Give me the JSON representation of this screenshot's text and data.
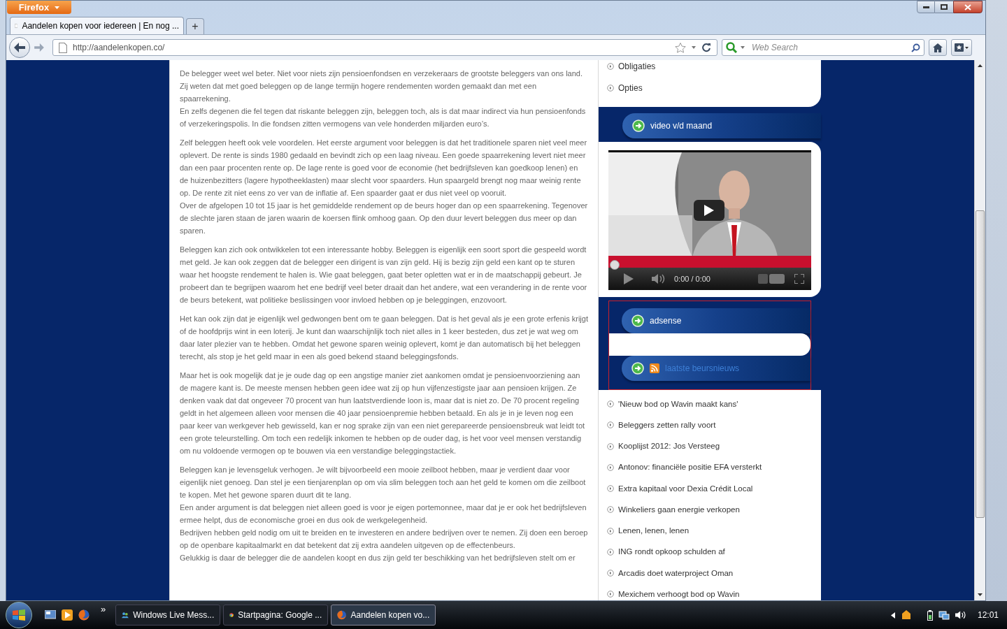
{
  "browser": {
    "menu_button": "Firefox",
    "tab": {
      "title": "Aandelen kopen voor iedereen | En nog ...",
      "selected": true
    },
    "new_tab": "+",
    "url": "http://aandelenkopen.co/",
    "search": {
      "placeholder": "Web Search"
    }
  },
  "article": {
    "paragraphs": [
      {
        "lines": [
          "De belegger weet wel beter. Niet voor niets zijn pensioenfondsen en verzekeraars de grootste beleggers van ons land. Zij weten dat met goed beleggen op de lange termijn hogere rendementen worden gemaakt dan met een spaarrekening.",
          "En zelfs degenen die fel tegen dat riskante beleggen zijn, beleggen toch, als is dat maar indirect via hun pensioenfonds of verzekeringspolis. In die fondsen zitten vermogens van vele honderden miljarden euro’s."
        ]
      },
      {
        "lines": [
          "Zelf beleggen heeft ook vele voordelen. Het eerste argument voor beleggen is dat het traditionele sparen niet veel meer oplevert. De rente is sinds 1980 gedaald en bevindt zich op een laag niveau. Een goede spaarrekening levert niet meer dan een paar procenten rente op. De lage rente is goed voor de economie (het bedrijfsleven kan goedkoop lenen) en de huizenbezitters (lagere hypotheeklasten) maar slecht voor spaarders. Hun spaargeld brengt nog maar weinig rente op. De rente zit niet eens zo ver van de inflatie af. Een spaarder gaat er dus niet veel op vooruit.",
          "Over de afgelopen 10 tot 15 jaar is het gemiddelde rendement op de beurs hoger dan op een spaarrekening. Tegenover de slechte jaren staan de jaren waarin de koersen flink omhoog gaan. Op den duur levert beleggen dus meer op dan sparen."
        ]
      },
      {
        "lines": [
          "Beleggen kan zich ook ontwikkelen tot een interessante hobby. Beleggen is eigenlijk een soort sport die gespeeld wordt met geld. Je kan ook zeggen dat de belegger een dirigent is van zijn geld. Hij is bezig zijn geld een kant op te sturen waar het hoogste rendement te halen is. Wie gaat beleggen, gaat beter opletten wat er in de maatschappij gebeurt. Je probeert dan te begrijpen waarom het ene bedrijf veel beter draait dan het andere, wat een verandering in de rente voor de beurs betekent, wat politieke beslissingen voor invloed hebben op je beleggingen, enzovoort."
        ]
      },
      {
        "lines": [
          "Het kan ook zijn dat je eigenlijk wel gedwongen bent om te gaan beleggen. Dat is het geval als je een grote erfenis krijgt of de hoofdprijs wint in een loterij. Je kunt dan waarschijnlijk toch niet alles in 1 keer besteden, dus zet je wat weg om daar later plezier van te hebben. Omdat het gewone sparen weinig oplevert, komt je dan automatisch bij het beleggen terecht, als stop je het geld maar in een als goed bekend staand beleggingsfonds."
        ]
      },
      {
        "lines": [
          "Maar het is ook mogelijk dat je je oude dag op een angstige manier ziet aankomen omdat je pensioenvoorziening aan de magere kant is. De meeste mensen hebben geen idee wat zij op hun vijfenzestigste jaar aan pensioen krijgen. Ze denken vaak dat dat ongeveer 70 procent van hun laatstverdiende loon is, maar dat is niet zo. De 70 procent regeling geldt in het algemeen alleen voor mensen die 40 jaar pensioenpremie hebben betaald. En als je in je leven nog een paar keer van werkgever heb gewisseld, kan er nog sprake zijn van een niet gerepareerde pensioensbreuk wat leidt tot een grote teleurstelling. Om toch een redelijk inkomen te hebben op de ouder dag, is het voor veel mensen verstandig om nu voldoende vermogen op te bouwen via een verstandige beleggingstactiek."
        ]
      },
      {
        "lines": [
          "Beleggen kan je levensgeluk verhogen. Je wilt bijvoorbeeld een mooie zeilboot hebben, maar je verdient daar voor eigenlijk niet genoeg. Dan stel je een tienjarenplan op om via slim beleggen toch aan het geld te komen om die zeilboot te kopen. Met het gewone sparen duurt dit te lang.",
          "Een ander argument is dat beleggen niet alleen goed is voor je eigen portemonnee, maar dat je er ook het bedrijfsleven ermee helpt, dus de economische groei en dus ook de werkgelegenheid.",
          "Bedrijven hebben geld nodig om uit te breiden en te investeren en andere bedrijven over te nemen. Zij doen een beroep op de openbare kapitaalmarkt en dat betekent dat zij extra aandelen uitgeven op de effectenbeurs.",
          "Gelukkig is daar de belegger die de aandelen koopt en dus zijn geld ter beschikking van het bedrijfsleven stelt om er"
        ]
      }
    ]
  },
  "sidebar": {
    "top_links": [
      "Obligaties",
      "Opties"
    ],
    "video_widget": {
      "title": "video v/d maand",
      "player": {
        "time": "0:00 / 0:00",
        "progress": {
          "level": 0
        }
      }
    },
    "ad_widget": {
      "title": "adsense"
    },
    "news_widget": {
      "title": "laatste beursnieuws",
      "items": [
        "'Nieuw bod op Wavin maakt kans'",
        "Beleggers zetten rally voort",
        "Kooplijst 2012: Jos Versteeg",
        "Antonov: financiële positie EFA versterkt",
        "Extra kapitaal voor Dexia Crédit Local",
        "Winkeliers gaan energie verkopen",
        "Lenen, lenen, lenen",
        "ING rondt opkoop schulden af",
        "Arcadis doet waterproject Oman",
        "Mexichem verhoogt bod op Wavin"
      ]
    }
  },
  "taskbar": {
    "overflow": "»",
    "tasks": [
      {
        "label": "Windows Live Mess...",
        "selected": false,
        "kind": "messenger"
      },
      {
        "label": "Startpagina: Google ...",
        "selected": false,
        "kind": "chrome"
      },
      {
        "label": "Aandelen kopen vo...",
        "selected": true,
        "kind": "firefox"
      }
    ],
    "clock": "12:01"
  }
}
